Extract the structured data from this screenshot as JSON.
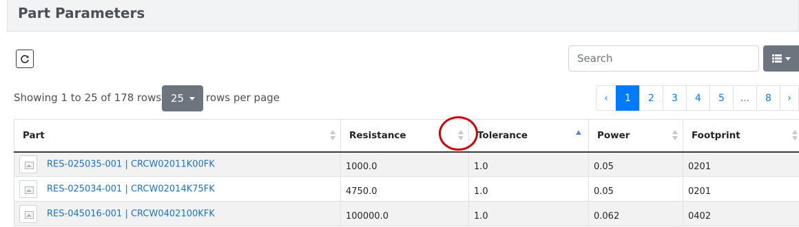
{
  "panel": {
    "title": "Part Parameters"
  },
  "toolbar": {
    "refresh_icon": "refresh-icon",
    "search_placeholder": "Search",
    "columns_icon": "list-icon"
  },
  "pagination_info": {
    "showing": "Showing 1 to 25 of 178 rows",
    "page_size": "25",
    "rows_per_page": "rows per page"
  },
  "pagination": {
    "prev": "‹",
    "pages": [
      "1",
      "2",
      "3",
      "4",
      "5",
      "...",
      "8"
    ],
    "next": "›",
    "current": "1"
  },
  "table": {
    "columns": [
      {
        "label": "Part",
        "sort": "none"
      },
      {
        "label": "Resistance",
        "sort": "none"
      },
      {
        "label": "Tolerance",
        "sort": "ascending"
      },
      {
        "label": "Power",
        "sort": "none"
      },
      {
        "label": "Footprint",
        "sort": "none"
      }
    ],
    "rows": [
      {
        "part": "RES-025035-001 | CRCW02011K00FK",
        "resistance": "1000.0",
        "tolerance": "1.0",
        "power": "0.05",
        "footprint": "0201"
      },
      {
        "part": "RES-025034-001 | CRCW02014K75FK",
        "resistance": "4750.0",
        "tolerance": "1.0",
        "power": "0.05",
        "footprint": "0201"
      },
      {
        "part": "RES-045016-001 | CRCW0402100KFK",
        "resistance": "100000.0",
        "tolerance": "1.0",
        "power": "0.062",
        "footprint": "0402"
      }
    ]
  },
  "colors": {
    "accent": "#007bff",
    "link": "#1a73c9",
    "button_secondary": "#6c757d",
    "annotation": "#cc0000"
  }
}
